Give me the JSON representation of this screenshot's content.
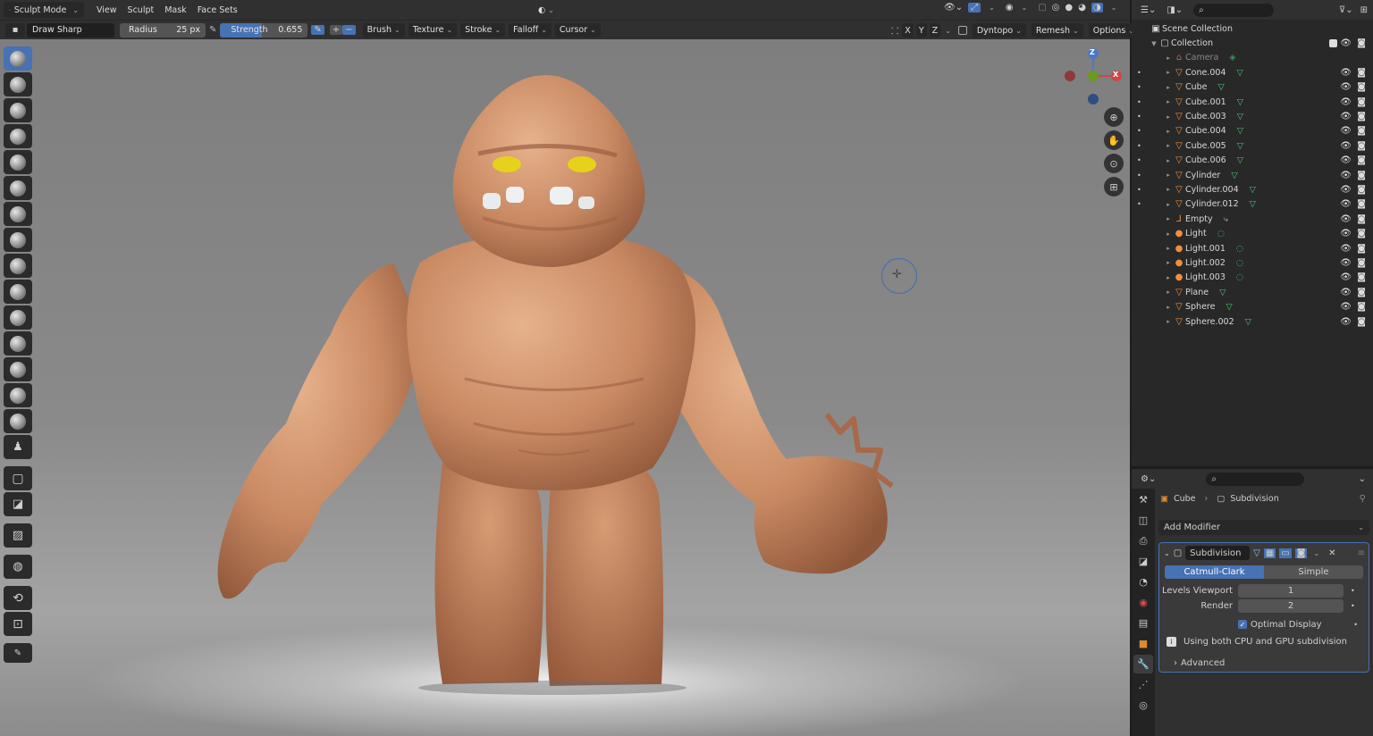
{
  "header": {
    "mode": "Sculpt Mode",
    "menus": [
      "View",
      "Sculpt",
      "Mask",
      "Face Sets"
    ]
  },
  "tool_settings": {
    "brush_name": "Draw Sharp",
    "radius_label": "Radius",
    "radius_value": "25 px",
    "strength_label": "Strength",
    "strength_value": "0.655",
    "strength_fraction": 0.655,
    "dropdowns": [
      "Brush",
      "Texture",
      "Stroke",
      "Falloff",
      "Cursor"
    ],
    "axes": [
      "X",
      "Y",
      "Z"
    ],
    "dyntopo": "Dyntopo",
    "remesh": "Remesh",
    "options": "Options"
  },
  "gizmo": {
    "z": "Z",
    "x": "X"
  },
  "outliner": {
    "scene_collection": "Scene Collection",
    "collection": "Collection",
    "items": [
      {
        "name": "Camera",
        "type": "camera"
      },
      {
        "name": "Cone.004",
        "type": "mesh"
      },
      {
        "name": "Cube",
        "type": "mesh"
      },
      {
        "name": "Cube.001",
        "type": "mesh"
      },
      {
        "name": "Cube.003",
        "type": "mesh"
      },
      {
        "name": "Cube.004",
        "type": "mesh"
      },
      {
        "name": "Cube.005",
        "type": "mesh"
      },
      {
        "name": "Cube.006",
        "type": "mesh"
      },
      {
        "name": "Cylinder",
        "type": "mesh"
      },
      {
        "name": "Cylinder.004",
        "type": "mesh"
      },
      {
        "name": "Cylinder.012",
        "type": "mesh"
      },
      {
        "name": "Empty",
        "type": "empty"
      },
      {
        "name": "Light",
        "type": "light"
      },
      {
        "name": "Light.001",
        "type": "light"
      },
      {
        "name": "Light.002",
        "type": "light"
      },
      {
        "name": "Light.003",
        "type": "light"
      },
      {
        "name": "Plane",
        "type": "mesh"
      },
      {
        "name": "Sphere",
        "type": "mesh"
      },
      {
        "name": "Sphere.002",
        "type": "mesh"
      }
    ]
  },
  "properties": {
    "breadcrumb_object": "Cube",
    "breadcrumb_modifier": "Subdivision",
    "add_modifier": "Add Modifier",
    "modifier_name": "Subdivision",
    "catmull_clark": "Catmull-Clark",
    "simple": "Simple",
    "levels_viewport_label": "Levels Viewport",
    "levels_viewport_value": "1",
    "render_label": "Render",
    "render_value": "2",
    "optimal_display": "Optimal Display",
    "info": "Using both CPU and GPU subdivision",
    "advanced": "Advanced"
  },
  "colors": {
    "accent": "#4772b3",
    "clay": "#c98a63",
    "eyes": "#e6d21a"
  }
}
